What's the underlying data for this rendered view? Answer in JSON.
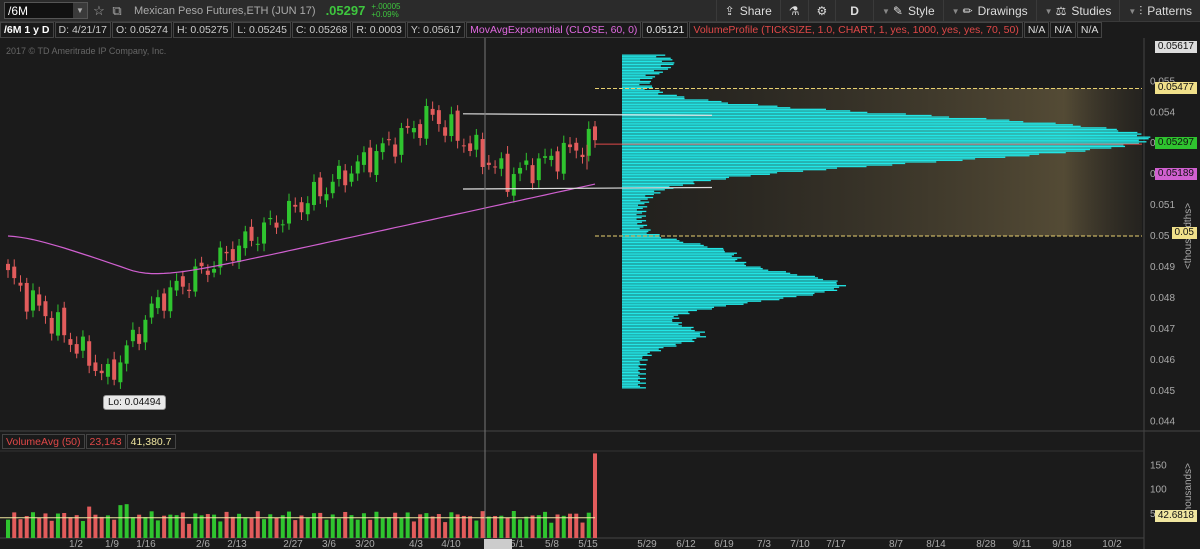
{
  "toolbar": {
    "symbol": "/6M",
    "description": "Mexican Peso Futures,ETH (JUN 17)",
    "last_price": ".05297",
    "change_abs": "+.00005",
    "change_pct": "+0.09%",
    "share_label": "Share",
    "aggregation": "D",
    "style_label": "Style",
    "drawings_label": "Drawings",
    "studies_label": "Studies",
    "patterns_label": "Patterns"
  },
  "study_bar": {
    "title": "/6M 1 y D",
    "date": "D: 4/21/17",
    "open": "O: 0.05274",
    "high": "H: 0.05275",
    "low": "L: 0.05245",
    "close": "C: 0.05268",
    "range": "R: 0.0003",
    "cursor_y": "Y: 0.05617",
    "ema_label": "MovAvgExponential (CLOSE, 60, 0)",
    "ema_value": "0.05121",
    "vp_label": "VolumeProfile (TICKSIZE, 1.0, CHART, 1, yes, 1000, yes, yes, 70, 50)",
    "na1": "N/A",
    "na2": "N/A",
    "na3": "N/A"
  },
  "copyright": "2017 © TD Ameritrade IP Company, Inc.",
  "lo_label": "Lo: 0.04494",
  "volume_header": {
    "name": "VolumeAvg (50)",
    "value1": "23,143",
    "value2": "41,380.7"
  },
  "price_labels": {
    "cursor": "0.05617",
    "value_high": "0.05477",
    "last": "0.05297",
    "ema": "0.05189",
    "value_low": "0.05",
    "volume_avg": "42.6818"
  },
  "colors": {
    "up": "#2fc42f",
    "down": "#e25c5c",
    "ema": "#d060d0",
    "profile": "#22e6e6",
    "background": "#1b1b1b"
  },
  "chart_data": {
    "type": "candlestick",
    "price_axis": {
      "ylim": [
        0.0437,
        0.0564
      ],
      "ticks": [
        "0.055",
        "0.054",
        "0.053",
        "0.052",
        "0.051",
        "0.05",
        "0.049",
        "0.048",
        "0.047",
        "0.046",
        "0.045",
        "0.044"
      ],
      "unit_label": "<thousandths>"
    },
    "volume_axis": {
      "ylim": [
        0,
        180
      ],
      "ticks": [
        "150",
        "100",
        "50"
      ],
      "unit_label": "<thousands>"
    },
    "x_ticks": [
      "1/2",
      "1/9",
      "1/16",
      "2/6",
      "2/13",
      "2/27",
      "3/6",
      "3/20",
      "4/3",
      "4/10",
      "4/21",
      "5/1",
      "5/8",
      "5/15",
      "5/29",
      "6/12",
      "6/19",
      "7/3",
      "7/10",
      "7/17",
      "8/7",
      "8/14",
      "8/28",
      "9/11",
      "9/18",
      "10/2"
    ],
    "low_marker": 0.04494,
    "value_area_high": 0.05477,
    "value_area_low": 0.05,
    "point_of_control": 0.05297
  }
}
